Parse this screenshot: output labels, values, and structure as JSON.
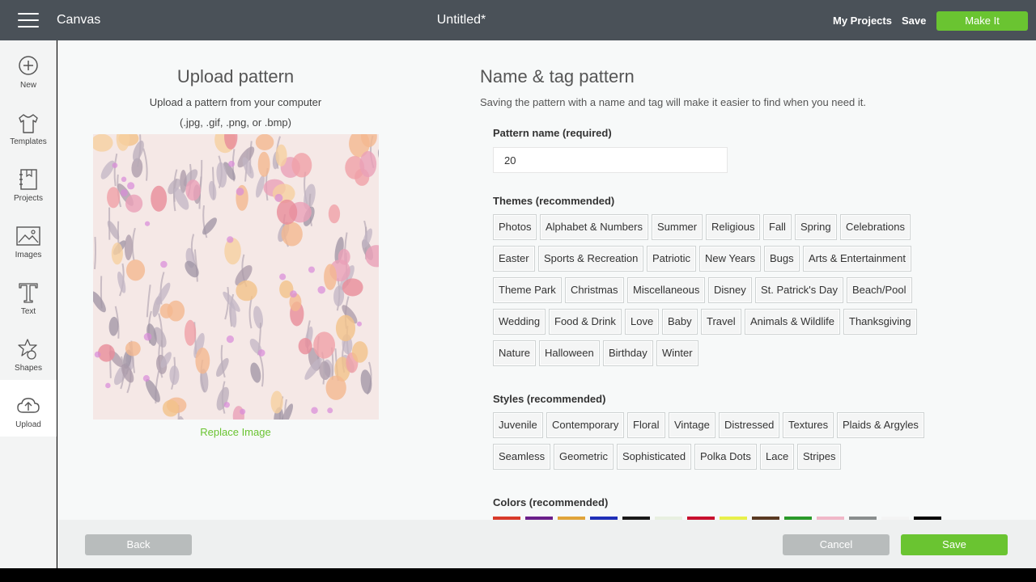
{
  "topbar": {
    "app_title": "Canvas",
    "doc_title": "Untitled*",
    "my_projects": "My Projects",
    "save": "Save",
    "make_it": "Make It"
  },
  "sidebar": {
    "items": [
      {
        "label": "New",
        "icon": "plus-circle-icon"
      },
      {
        "label": "Templates",
        "icon": "tshirt-icon"
      },
      {
        "label": "Projects",
        "icon": "notebook-icon"
      },
      {
        "label": "Images",
        "icon": "image-icon"
      },
      {
        "label": "Text",
        "icon": "text-icon"
      },
      {
        "label": "Shapes",
        "icon": "shapes-icon"
      },
      {
        "label": "Upload",
        "icon": "cloud-upload-icon",
        "active": true
      }
    ]
  },
  "upload": {
    "title": "Upload pattern",
    "subtitle": "Upload a pattern from your computer",
    "formats": "(.jpg, .gif, .png, or .bmp)",
    "replace": "Replace Image"
  },
  "naming": {
    "title": "Name & tag pattern",
    "subtitle": "Saving the pattern with a name and tag will make it easier to find when you need it.",
    "name_label": "Pattern name (required)",
    "name_value": "20",
    "themes_label": "Themes (recommended)",
    "themes": [
      [
        "Photos",
        "Alphabet & Numbers",
        "Summer",
        "Religious",
        "Fall",
        "Spring",
        "Celebrations"
      ],
      [
        "Easter",
        "Sports & Recreation",
        "Patriotic",
        "New Years",
        "Bugs",
        "Arts & Entertainment"
      ],
      [
        "Theme Park",
        "Christmas",
        "Miscellaneous",
        "Disney",
        "St. Patrick's Day",
        "Beach/Pool"
      ],
      [
        "Wedding",
        "Food & Drink",
        "Love",
        "Baby",
        "Travel",
        "Animals & Wildlife",
        "Thanksgiving"
      ],
      [
        "Nature",
        "Halloween",
        "Birthday",
        "Winter"
      ]
    ],
    "styles_label": "Styles (recommended)",
    "styles": [
      [
        "Juvenile",
        "Contemporary",
        "Floral",
        "Vintage",
        "Distressed",
        "Textures",
        "Plaids & Argyles"
      ],
      [
        "Seamless",
        "Geometric",
        "Sophisticated",
        "Polka Dots",
        "Lace",
        "Stripes"
      ]
    ],
    "colors_label": "Colors (recommended)",
    "colors": [
      "#d83a2a",
      "#6a1f8a",
      "#e0a43a",
      "#1f2fb8",
      "#1a1a1a",
      "#e8f0e0",
      "#c8102e",
      "#e8f04a",
      "#5a3a22",
      "#2a9a2a",
      "#f0b8c8",
      "#8a8e8e",
      "#f4f4f4",
      "#000000"
    ]
  },
  "footer": {
    "back": "Back",
    "cancel": "Cancel",
    "save": "Save"
  }
}
